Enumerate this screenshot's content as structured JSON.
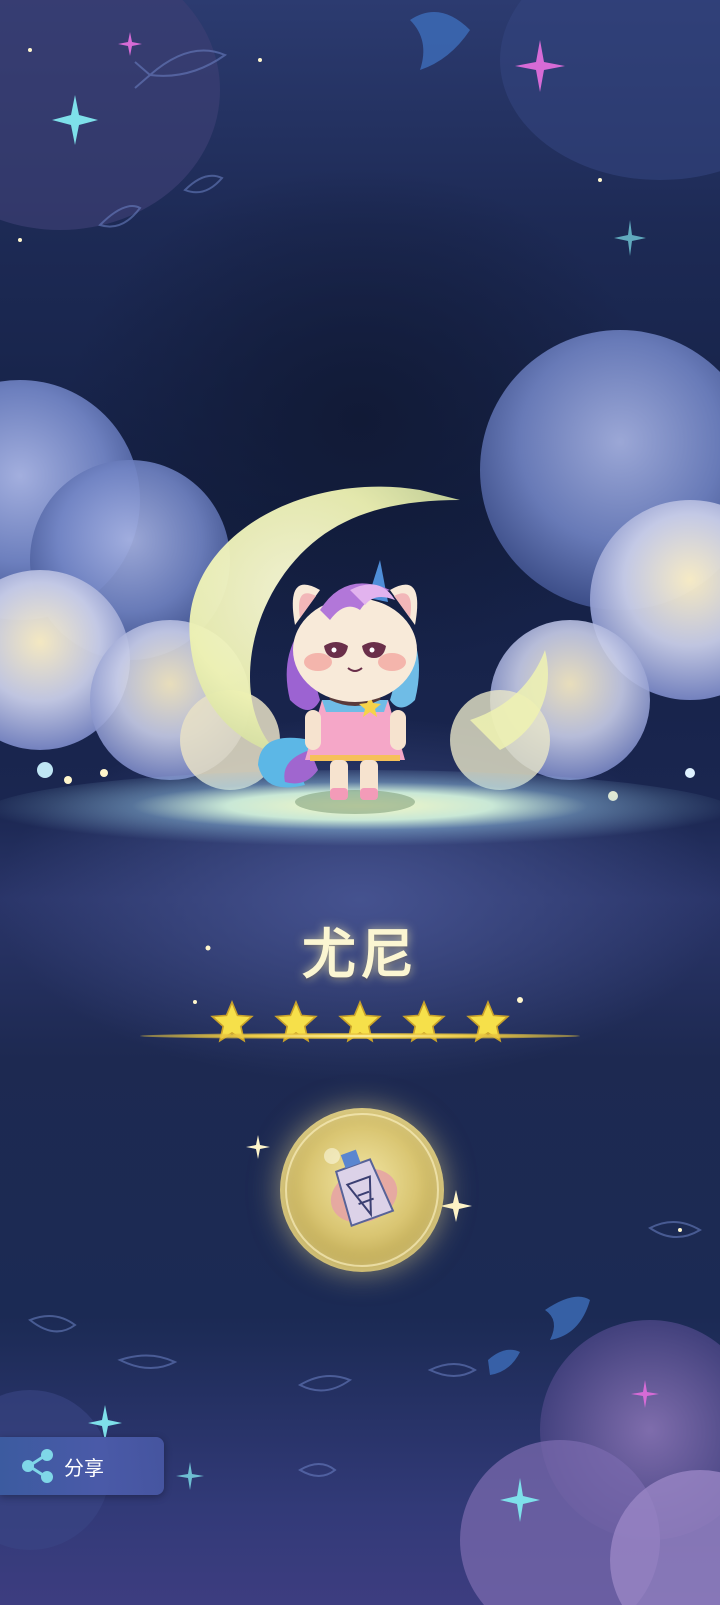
{
  "pet": {
    "name": "尤尼",
    "rating": 5,
    "rating_max": 5
  },
  "share": {
    "label": "分享",
    "icon": "share-icon"
  },
  "item": {
    "icon": "potion-bottle-icon"
  },
  "colors": {
    "star": "#f6e04a",
    "accent_gold": "#e9c640",
    "share_bg": "#3c5ba0",
    "sky": "#142044"
  }
}
